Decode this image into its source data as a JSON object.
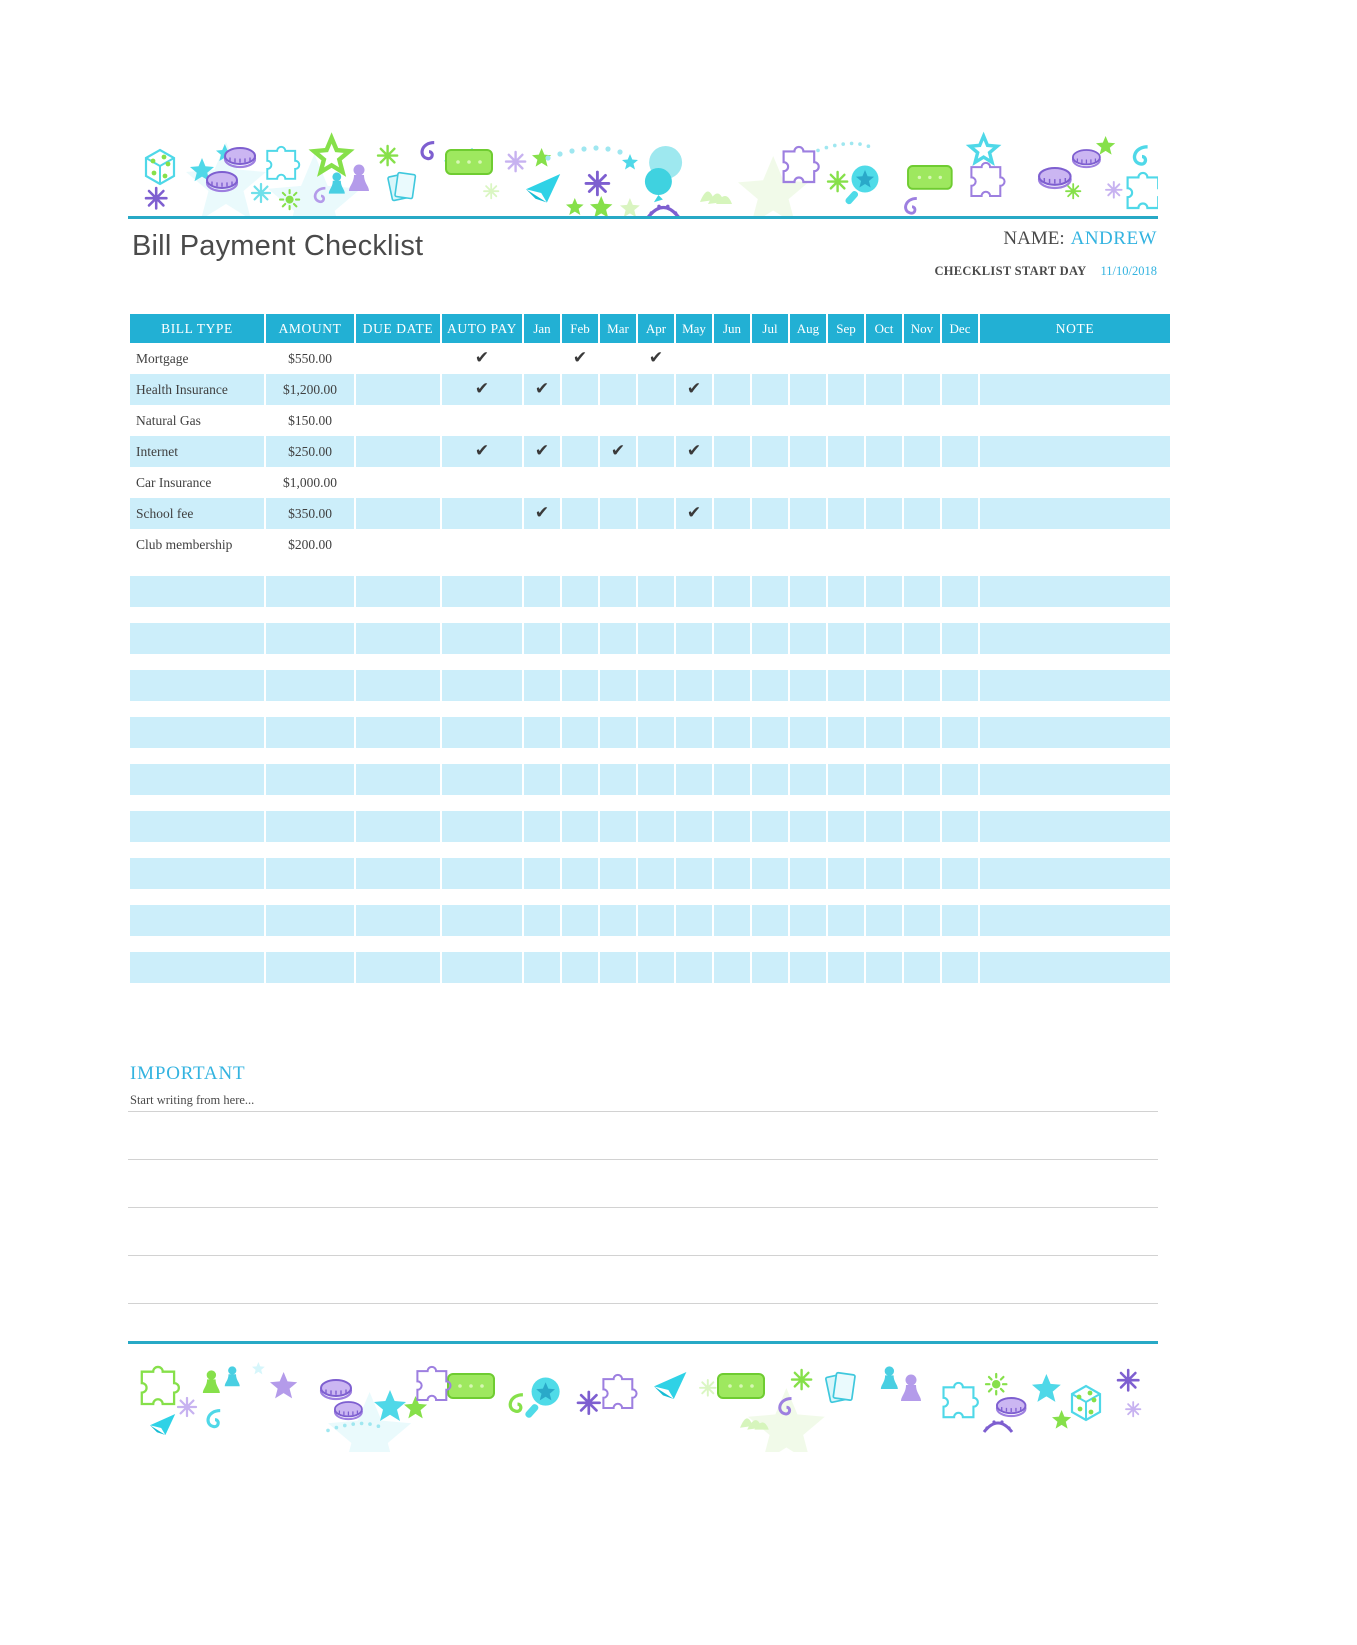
{
  "document": {
    "title": "Bill Payment Checklist",
    "name_label": "NAME:",
    "name_value": "ANDREW",
    "start_label": "CHECKLIST START DAY",
    "start_value": "11/10/2018"
  },
  "theme": {
    "header_blue": "#22b0d4",
    "row_fill": "#cceefa",
    "accent_text": "#33b3e0",
    "rule": "#27a9c6",
    "note_line": "#d2d2d2"
  },
  "table": {
    "columns": [
      "BILL TYPE",
      "AMOUNT",
      "DUE DATE",
      "AUTO PAY",
      "Jan",
      "Feb",
      "Mar",
      "Apr",
      "May",
      "Jun",
      "Jul",
      "Aug",
      "Sep",
      "Oct",
      "Nov",
      "Dec",
      "NOTE"
    ],
    "check_glyph": "✔",
    "rows": [
      {
        "bill_type": "Mortgage",
        "amount": "$550.00",
        "due_date": "",
        "note": "",
        "auto_pay": true,
        "months": [
          false,
          true,
          false,
          true,
          false,
          false,
          false,
          false,
          false,
          false,
          false,
          false
        ]
      },
      {
        "bill_type": "Health Insurance",
        "amount": "$1,200.00",
        "due_date": "",
        "note": "",
        "auto_pay": true,
        "months": [
          true,
          false,
          false,
          false,
          true,
          false,
          false,
          false,
          false,
          false,
          false,
          false
        ]
      },
      {
        "bill_type": "Natural Gas",
        "amount": "$150.00",
        "due_date": "",
        "note": "",
        "auto_pay": false,
        "months": [
          false,
          false,
          false,
          false,
          false,
          false,
          false,
          false,
          false,
          false,
          false,
          false
        ]
      },
      {
        "bill_type": "Internet",
        "amount": "$250.00",
        "due_date": "",
        "note": "",
        "auto_pay": true,
        "months": [
          true,
          false,
          true,
          false,
          true,
          false,
          false,
          false,
          false,
          false,
          false,
          false
        ]
      },
      {
        "bill_type": "Car Insurance",
        "amount": "$1,000.00",
        "due_date": "",
        "note": "",
        "auto_pay": false,
        "months": [
          false,
          false,
          false,
          false,
          false,
          false,
          false,
          false,
          false,
          false,
          false,
          false
        ]
      },
      {
        "bill_type": "School fee",
        "amount": "$350.00",
        "due_date": "",
        "note": "",
        "auto_pay": false,
        "months": [
          true,
          false,
          false,
          false,
          true,
          false,
          false,
          false,
          false,
          false,
          false,
          false
        ]
      },
      {
        "bill_type": "Club membership",
        "amount": "$200.00",
        "due_date": "",
        "note": "",
        "auto_pay": false,
        "months": [
          false,
          false,
          false,
          false,
          false,
          false,
          false,
          false,
          false,
          false,
          false,
          false
        ]
      }
    ],
    "blank_row_count": 9
  },
  "important": {
    "heading": "IMPORTANT",
    "placeholder": "Start writing from here...",
    "line_count": 5
  },
  "decoration": {
    "top_band_name": "party-doodle-border",
    "bottom_band_name": "party-doodle-border",
    "motifs": [
      "dice",
      "star",
      "coins",
      "puzzle-piece",
      "snowflake",
      "game-pawn",
      "playing-cards",
      "paper-plane",
      "balloon",
      "confetti",
      "ticket",
      "spiral"
    ]
  }
}
